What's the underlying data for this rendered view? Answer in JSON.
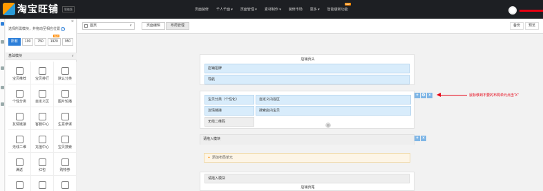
{
  "brand": {
    "name": "淘宝旺铺",
    "tag": "智能版"
  },
  "topnav": [
    {
      "label": "页面装修",
      "badge": ""
    },
    {
      "label": "千人千面 ▾",
      "badge": ""
    },
    {
      "label": "页面管理 ▾",
      "badge": ""
    },
    {
      "label": "素材制作 ▾",
      "badge": ""
    },
    {
      "label": "装修市场",
      "badge": ""
    },
    {
      "label": "更多 ▾",
      "badge": ""
    },
    {
      "label": "智能版新功能",
      "badge": "NEW"
    }
  ],
  "panel": {
    "close": "×",
    "hint": "选择所需模块，并拖动至相应位置",
    "help": "?",
    "widths": [
      {
        "label": "所有",
        "tag": ""
      },
      {
        "label": "190",
        "tag": ""
      },
      {
        "label": "750",
        "tag": ""
      },
      {
        "label": "1920",
        "tag": "NEW"
      },
      {
        "label": "950",
        "tag": ""
      }
    ],
    "section": "基础模块",
    "section_chev": "∨",
    "modules": [
      {
        "label": "宝贝推荐",
        "icon": "bag-icon"
      },
      {
        "label": "宝贝排行",
        "icon": "ranking-icon"
      },
      {
        "label": "默认分类",
        "icon": "category-icon"
      },
      {
        "label": "个性分类",
        "icon": "custom-category-icon"
      },
      {
        "label": "自定义区",
        "icon": "grid-icon"
      },
      {
        "label": "图片轮播",
        "icon": "carousel-icon"
      },
      {
        "label": "友情链接",
        "icon": "link-icon"
      },
      {
        "label": "客服中心",
        "icon": "service-icon"
      },
      {
        "label": "生意参谋",
        "icon": "compass-icon"
      },
      {
        "label": "无线二维",
        "icon": "qrcode-icon"
      },
      {
        "label": "充值中心",
        "icon": "recharge-icon"
      },
      {
        "label": "宝贝搜索",
        "icon": "search-icon"
      },
      {
        "label": "满返",
        "icon": "grid-icon"
      },
      {
        "label": "红包",
        "icon": "redpacket-icon"
      },
      {
        "label": "购物券",
        "icon": "coupon-icon"
      },
      {
        "label": "",
        "icon": "grid-icon"
      },
      {
        "label": "",
        "icon": "grid-icon"
      },
      {
        "label": "",
        "icon": "list-icon"
      }
    ]
  },
  "toolbar": {
    "page": "首页",
    "tabs": [
      "页面编辑",
      "布局管理"
    ],
    "right": [
      "备份",
      "预览"
    ]
  },
  "canvas": {
    "header_title": "店铺页头",
    "header_rows": [
      "店铺招牌",
      "导航"
    ],
    "middle_left": [
      "宝贝分类（个性化）",
      "友情链接",
      "无线二维码"
    ],
    "middle_right": [
      "自定义内容区",
      "搜索店内宝贝"
    ],
    "drop_hint_1": "请拖入模块",
    "add_unit": "添加布局单元",
    "drop_hint_2": "请拖入模块",
    "footer_title": "店铺页尾"
  },
  "controls": {
    "add": "+",
    "settings": "⚙",
    "delete": "×"
  },
  "annotation": "鼠标移到不要的布局单元点击“X”",
  "colors": {
    "accent": "#2d7fd9",
    "highlight": "#e60012",
    "new_badge": "#ff8a00"
  }
}
